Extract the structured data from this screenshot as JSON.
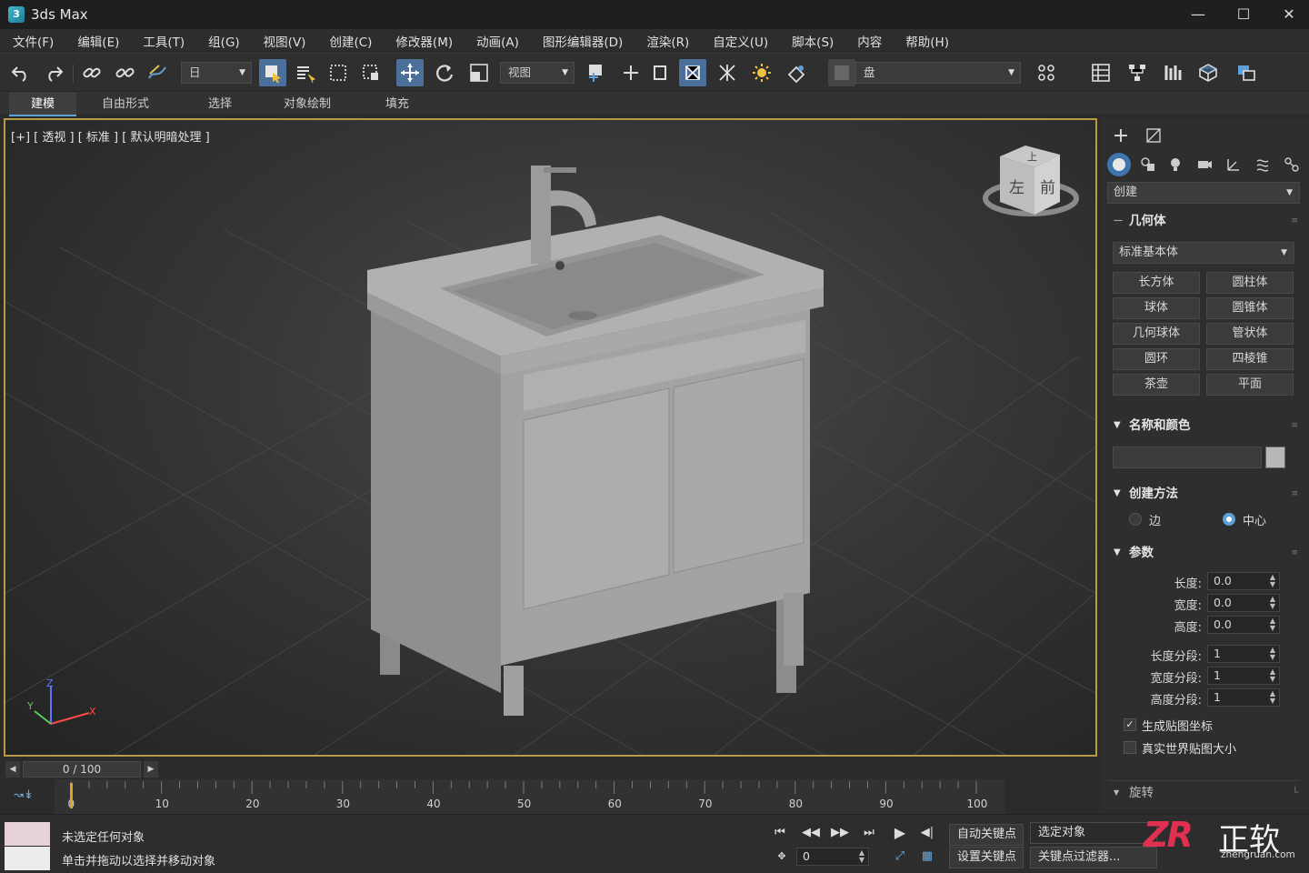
{
  "app": {
    "title": "3ds Max",
    "logo": "3"
  },
  "menu": [
    "文件(F)",
    "编辑(E)",
    "工具(T)",
    "组(G)",
    "视图(V)",
    "创建(C)",
    "修改器(M)",
    "动画(A)",
    "图形编辑器(D)",
    "渲染(R)",
    "自定义(U)",
    "脚本(S)",
    "内容",
    "帮助(H)"
  ],
  "toolbar": {
    "selection_filter": "日",
    "reference_coord": "视图",
    "named_selection": "盘"
  },
  "ribbon": {
    "tabs": [
      "建模",
      "自由形式",
      "选择",
      "对象绘制",
      "填充"
    ],
    "active": 0
  },
  "viewport": {
    "label": "[+] [ 透视 ] [ 标准 ] [ 默认明暗处理 ]",
    "viewcube": {
      "top": "上",
      "left": "左",
      "front": "前"
    },
    "axes": {
      "x": "X",
      "y": "Y",
      "z": "Z"
    }
  },
  "command_panel": {
    "category_dropdown": "创建",
    "geometry_rollout": "几何体",
    "object_type_dropdown": "标准基本体",
    "object_buttons": [
      "长方体",
      "圆柱体",
      "球体",
      "圆锥体",
      "几何球体",
      "管状体",
      "圆环",
      "四棱锥",
      "茶壶",
      "平面"
    ],
    "name_color_rollout": "名称和颜色",
    "creation_method_rollout": "创建方法",
    "creation_methods": {
      "edge": "边",
      "center": "中心",
      "selected": "center"
    },
    "parameters_rollout": "参数",
    "params": [
      {
        "label": "长度:",
        "value": "0.0"
      },
      {
        "label": "宽度:",
        "value": "0.0"
      },
      {
        "label": "高度:",
        "value": "0.0"
      },
      {
        "label": "长度分段:",
        "value": "1"
      },
      {
        "label": "宽度分段:",
        "value": "1"
      },
      {
        "label": "高度分段:",
        "value": "1"
      }
    ],
    "checkboxes": [
      {
        "label": "生成贴图坐标",
        "checked": true
      },
      {
        "label": "真实世界贴图大小",
        "checked": false
      }
    ],
    "bottom_rollout": "旋转"
  },
  "timeline": {
    "frame_display": "0 / 100",
    "ticks": [
      "0",
      "10",
      "20",
      "30",
      "40",
      "50",
      "60",
      "70",
      "80",
      "90",
      "100"
    ],
    "current_frame_fraction": 0
  },
  "status": {
    "line1": "未选定任何对象",
    "line2": "单击并拖动以选择并移动对象",
    "auto_key": "自动关键点",
    "set_key": "设置关键点",
    "selected_object": "选定对象",
    "key_filters": "关键点过滤器...",
    "frame_value": "0"
  },
  "watermark": {
    "logo": "ZR",
    "brand": "正软",
    "url": "zhengruan.com"
  },
  "colors": {
    "accent": "#4a6f9a",
    "viewport_border": "#b89a45",
    "active_radio": "#5fa0d8",
    "time_slider": "#e0a030"
  }
}
